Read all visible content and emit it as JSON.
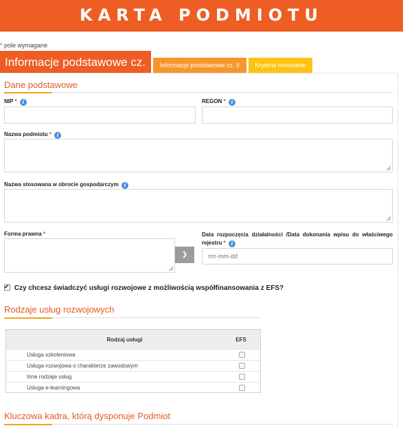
{
  "header": {
    "title": "KARTA PODMIOTU"
  },
  "required_note": {
    "star": "*",
    "text": "pole wymagane"
  },
  "tabs": [
    {
      "label": "Informacje podstawowe cz. I",
      "active": true
    },
    {
      "label": "Informacje podstawowe cz. II",
      "active": false
    },
    {
      "label": "Kryteria minimalne",
      "active": false
    }
  ],
  "sections": {
    "basic": "Dane podstawowe",
    "services": "Rodzaje usług rozwojowych",
    "staff": "Kluczowa kadra, którą dysponuje Podmiot"
  },
  "fields": {
    "nip": {
      "label": "NIP",
      "required": "*",
      "value": ""
    },
    "regon": {
      "label": "REGON",
      "required": "*",
      "value": ""
    },
    "name": {
      "label": "Nazwa podmiotu",
      "required": "*",
      "value": ""
    },
    "trade_name": {
      "label": "Nazwa stosowana w obrocie gospodarczym",
      "value": ""
    },
    "legal_form": {
      "label": "Forma prawna",
      "required": "*",
      "value": ""
    },
    "start_date": {
      "label": "Data rozpoczęcia działalności /Data dokonania wpisu do właściwego rejestru",
      "required": "*",
      "placeholder": "rrrr-mm-dd"
    }
  },
  "efs_checkbox": {
    "label": "Czy chcesz świadczyć usługi rozwojowe z możliwością współfinansowania z EFS?",
    "checked": true
  },
  "services_table": {
    "headers": {
      "name": "Rodzaj usługi",
      "efs": "EFS"
    },
    "rows": [
      {
        "name": "Usługa szkoleniowa",
        "efs": false
      },
      {
        "name": "Usługa rozwojowa o charakterze zawodowym",
        "efs": false
      },
      {
        "name": "Inne rodzaje usług",
        "efs": false
      },
      {
        "name": "Usługa e-learningowa",
        "efs": false
      }
    ]
  },
  "icons": {
    "info": "info-icon",
    "dropdown": "chevron-down-icon",
    "check": "check-icon"
  },
  "colors": {
    "brand": "#ee5d24",
    "tab2": "#f7962d",
    "tab3": "#fcc412",
    "info": "#4a90d9"
  }
}
